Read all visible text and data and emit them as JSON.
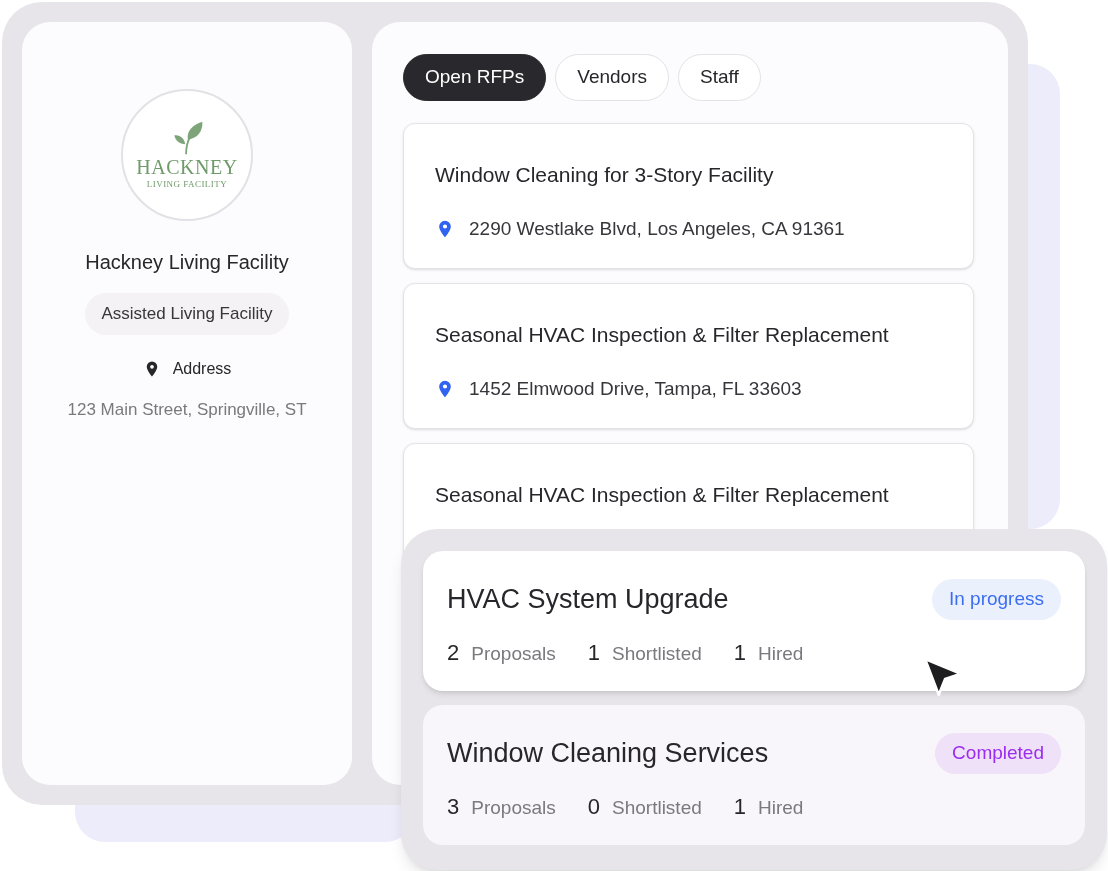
{
  "facility": {
    "logo": {
      "name": "HACKNEY",
      "subtitle": "LIVING FACILITY"
    },
    "name": "Hackney Living Facility",
    "type": "Assisted Living Facility",
    "address_label": "Address",
    "address": "123 Main Street, Springville, ST"
  },
  "tabs": [
    {
      "label": "Open RFPs",
      "selected": true
    },
    {
      "label": "Vendors",
      "selected": false
    },
    {
      "label": "Staff",
      "selected": false
    }
  ],
  "rfps": [
    {
      "title": "Window Cleaning for 3-Story Facility",
      "address": "2290 Westlake Blvd, Los Angeles, CA 91361"
    },
    {
      "title": "Seasonal HVAC Inspection & Filter Replacement",
      "address": "1452 Elmwood Drive, Tampa, FL 33603"
    },
    {
      "title": "Seasonal HVAC Inspection & Filter Replacement"
    }
  ],
  "projects": [
    {
      "title": "HVAC System Upgrade",
      "status": "In progress",
      "color": "#3b6ef0",
      "stats": [
        {
          "count": "2",
          "label": "Proposals"
        },
        {
          "count": "1",
          "label": "Shortlisted"
        },
        {
          "count": "1",
          "label": "Hired"
        }
      ]
    },
    {
      "title": "Window Cleaning Services",
      "status": "Completed",
      "color": "#9b2cf0",
      "stats": [
        {
          "count": "3",
          "label": "Proposals"
        },
        {
          "count": "0",
          "label": "Shortlisted"
        },
        {
          "count": "1",
          "label": "Hired"
        }
      ]
    }
  ]
}
